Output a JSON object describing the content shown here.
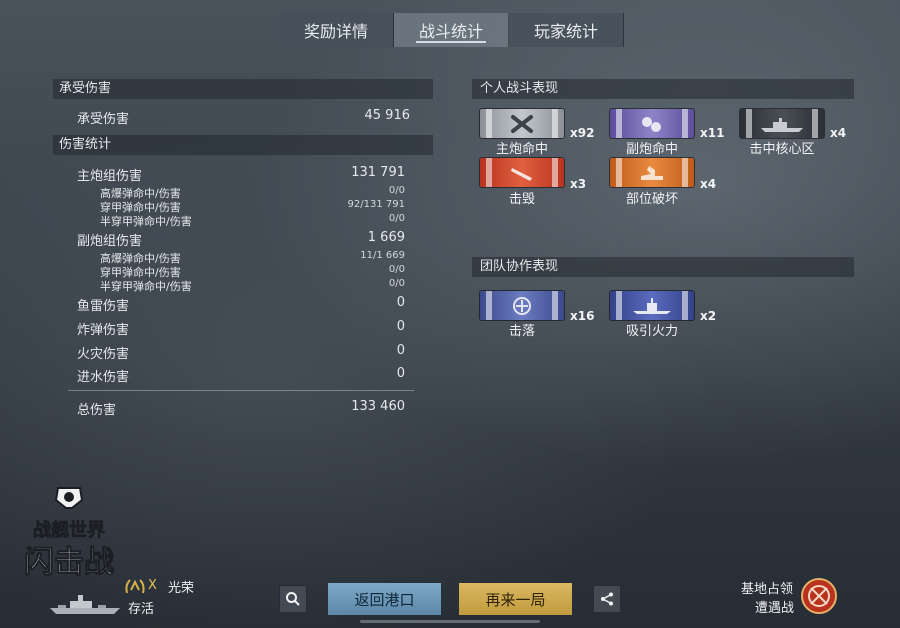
{
  "tabs": [
    "奖励详情",
    "战斗统计",
    "玩家统计"
  ],
  "left": {
    "received_header": "承受伤害",
    "received_row": {
      "label": "承受伤害",
      "value": "45 916"
    },
    "damage_header": "伤害统计",
    "main_battery": {
      "label": "主炮组伤害",
      "value": "131 791"
    },
    "main_sub": [
      {
        "label": "高爆弹命中/伤害",
        "value": "0/0"
      },
      {
        "label": "穿甲弹命中/伤害",
        "value": "92/131 791"
      },
      {
        "label": "半穿甲弹命中/伤害",
        "value": "0/0"
      }
    ],
    "secondary": {
      "label": "副炮组伤害",
      "value": "1 669"
    },
    "secondary_sub": [
      {
        "label": "高爆弹命中/伤害",
        "value": "11/1 669"
      },
      {
        "label": "穿甲弹命中/伤害",
        "value": "0/0"
      },
      {
        "label": "半穿甲弹命中/伤害",
        "value": "0/0"
      }
    ],
    "torpedo": {
      "label": "鱼雷伤害",
      "value": "0"
    },
    "bomb": {
      "label": "炸弹伤害",
      "value": "0"
    },
    "fire": {
      "label": "火灾伤害",
      "value": "0"
    },
    "flood": {
      "label": "进水伤害",
      "value": "0"
    },
    "total": {
      "label": "总伤害",
      "value": "133 460"
    }
  },
  "right": {
    "personal_header": "个人战斗表现",
    "personal": [
      {
        "label": "主炮命中",
        "count": "x92",
        "color": "#b8bdc2",
        "icon": "crossed-shells-icon"
      },
      {
        "label": "副炮命中",
        "count": "x11",
        "color": "#7d6fbf",
        "icon": "secondary-shells-icon"
      },
      {
        "label": "击中核心区",
        "count": "x4",
        "color": "#3a3f46",
        "icon": "citadel-ship-icon"
      },
      {
        "label": "击毁",
        "count": "x3",
        "color": "#d04a30",
        "icon": "destroyed-icon"
      },
      {
        "label": "部位破坏",
        "count": "x4",
        "color": "#dd7a35",
        "icon": "module-damage-icon"
      }
    ],
    "team_header": "团队协作表现",
    "team": [
      {
        "label": "击落",
        "count": "x16",
        "color": "#5e6db5",
        "icon": "shot-down-icon"
      },
      {
        "label": "吸引火力",
        "count": "x2",
        "color": "#4d5db0",
        "icon": "tank-ship-icon"
      }
    ]
  },
  "logo": {
    "line1": "战舰世界",
    "line2": "闪击战"
  },
  "player": {
    "rank": "X",
    "title": "光荣",
    "status": "存活"
  },
  "buttons": {
    "port": "返回港口",
    "again": "再来一局"
  },
  "mode": {
    "line1": "基地占领",
    "line2": "遭遇战"
  }
}
